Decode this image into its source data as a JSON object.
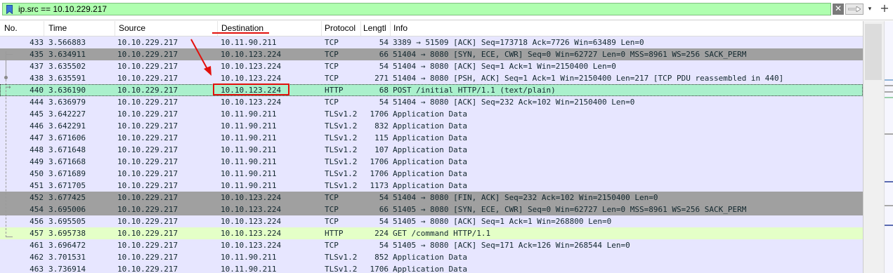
{
  "filter": {
    "value": "ip.src == 10.10.229.217",
    "clear_glyph": "✕",
    "dropdown_glyph": "▾",
    "add_glyph": "+",
    "colors": {
      "valid_bg": "#afffaf"
    }
  },
  "columns": [
    "No.",
    "Time",
    "Source",
    "Destination",
    "Protocol",
    "Lengtl",
    "Info"
  ],
  "rows": [
    {
      "no": "433",
      "time": "3.566883",
      "src": "10.10.229.217",
      "dst": "10.11.90.211",
      "proto": "TCP",
      "len": "54",
      "info": "3389 → 51509 [ACK] Seq=173718 Ack=7726 Win=63489 Len=0",
      "style": "tcp"
    },
    {
      "no": "435",
      "time": "3.634911",
      "src": "10.10.229.217",
      "dst": "10.10.123.224",
      "proto": "TCP",
      "len": "66",
      "info": "51404 → 8080 [SYN, ECE, CWR] Seq=0 Win=62727 Len=0 MSS=8961 WS=256 SACK_PERM",
      "style": "grey"
    },
    {
      "no": "437",
      "time": "3.635502",
      "src": "10.10.229.217",
      "dst": "10.10.123.224",
      "proto": "TCP",
      "len": "54",
      "info": "51404 → 8080 [ACK] Seq=1 Ack=1 Win=2150400 Len=0",
      "style": "tcp"
    },
    {
      "no": "438",
      "time": "3.635591",
      "src": "10.10.229.217",
      "dst": "10.10.123.224",
      "proto": "TCP",
      "len": "271",
      "info": "51404 → 8080 [PSH, ACK] Seq=1 Ack=1 Win=2150400 Len=217 [TCP PDU reassembled in 440]",
      "style": "tcp"
    },
    {
      "no": "440",
      "time": "3.636190",
      "src": "10.10.229.217",
      "dst": "10.10.123.224",
      "proto": "HTTP",
      "len": "68",
      "info": "POST /initial HTTP/1.1  (text/plain)",
      "style": "sel"
    },
    {
      "no": "444",
      "time": "3.636979",
      "src": "10.10.229.217",
      "dst": "10.10.123.224",
      "proto": "TCP",
      "len": "54",
      "info": "51404 → 8080 [ACK] Seq=232 Ack=102 Win=2150400 Len=0",
      "style": "tcp"
    },
    {
      "no": "445",
      "time": "3.642227",
      "src": "10.10.229.217",
      "dst": "10.11.90.211",
      "proto": "TLSv1.2",
      "len": "1706",
      "info": "Application Data",
      "style": "tcp"
    },
    {
      "no": "446",
      "time": "3.642291",
      "src": "10.10.229.217",
      "dst": "10.11.90.211",
      "proto": "TLSv1.2",
      "len": "832",
      "info": "Application Data",
      "style": "tcp"
    },
    {
      "no": "447",
      "time": "3.671606",
      "src": "10.10.229.217",
      "dst": "10.11.90.211",
      "proto": "TLSv1.2",
      "len": "115",
      "info": "Application Data",
      "style": "tcp"
    },
    {
      "no": "448",
      "time": "3.671648",
      "src": "10.10.229.217",
      "dst": "10.11.90.211",
      "proto": "TLSv1.2",
      "len": "107",
      "info": "Application Data",
      "style": "tcp"
    },
    {
      "no": "449",
      "time": "3.671668",
      "src": "10.10.229.217",
      "dst": "10.11.90.211",
      "proto": "TLSv1.2",
      "len": "1706",
      "info": "Application Data",
      "style": "tcp"
    },
    {
      "no": "450",
      "time": "3.671689",
      "src": "10.10.229.217",
      "dst": "10.11.90.211",
      "proto": "TLSv1.2",
      "len": "1706",
      "info": "Application Data",
      "style": "tcp"
    },
    {
      "no": "451",
      "time": "3.671705",
      "src": "10.10.229.217",
      "dst": "10.11.90.211",
      "proto": "TLSv1.2",
      "len": "1173",
      "info": "Application Data",
      "style": "tcp"
    },
    {
      "no": "452",
      "time": "3.677425",
      "src": "10.10.229.217",
      "dst": "10.10.123.224",
      "proto": "TCP",
      "len": "54",
      "info": "51404 → 8080 [FIN, ACK] Seq=232 Ack=102 Win=2150400 Len=0",
      "style": "grey"
    },
    {
      "no": "454",
      "time": "3.695006",
      "src": "10.10.229.217",
      "dst": "10.10.123.224",
      "proto": "TCP",
      "len": "66",
      "info": "51405 → 8080 [SYN, ECE, CWR] Seq=0 Win=62727 Len=0 MSS=8961 WS=256 SACK_PERM",
      "style": "grey"
    },
    {
      "no": "456",
      "time": "3.695505",
      "src": "10.10.229.217",
      "dst": "10.10.123.224",
      "proto": "TCP",
      "len": "54",
      "info": "51405 → 8080 [ACK] Seq=1 Ack=1 Win=268800 Len=0",
      "style": "tcp"
    },
    {
      "no": "457",
      "time": "3.695738",
      "src": "10.10.229.217",
      "dst": "10.10.123.224",
      "proto": "HTTP",
      "len": "224",
      "info": "GET /command HTTP/1.1",
      "style": "http"
    },
    {
      "no": "461",
      "time": "3.696472",
      "src": "10.10.229.217",
      "dst": "10.10.123.224",
      "proto": "TCP",
      "len": "54",
      "info": "51405 → 8080 [ACK] Seq=171 Ack=126 Win=268544 Len=0",
      "style": "tcp"
    },
    {
      "no": "462",
      "time": "3.701531",
      "src": "10.10.229.217",
      "dst": "10.11.90.211",
      "proto": "TLSv1.2",
      "len": "852",
      "info": "Application Data",
      "style": "tcp"
    },
    {
      "no": "463",
      "time": "3.736914",
      "src": "10.10.229.217",
      "dst": "10.11.90.211",
      "proto": "TLSv1.2",
      "len": "1706",
      "info": "Application Data",
      "style": "tcp"
    }
  ],
  "row_colors": {
    "tcp": "#e7e6ff",
    "grey": "#a0a0a0",
    "http": "#e4ffc7",
    "selected": "#aaf0cc"
  },
  "annotation_color": "#e2100c"
}
